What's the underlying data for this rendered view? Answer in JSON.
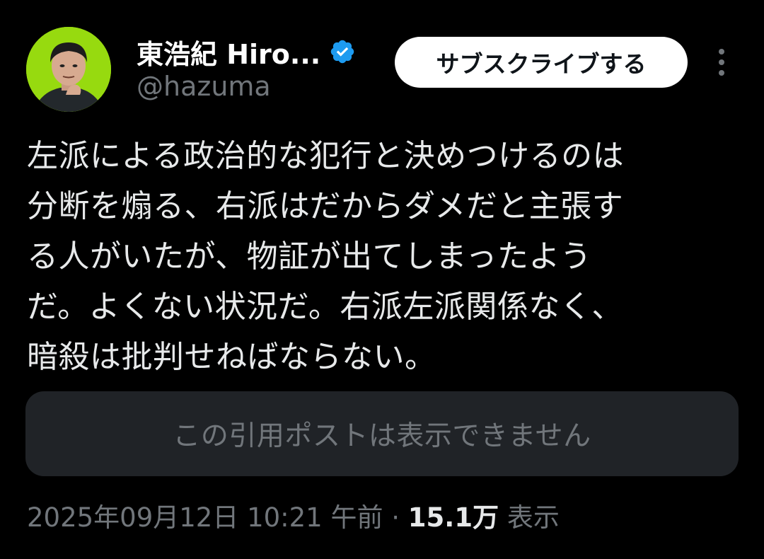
{
  "author": {
    "display_name": "東浩紀 Hiro...",
    "handle": "@hazuma",
    "verified_icon": "verified-badge-icon",
    "verified_color": "#1d9bf0",
    "avatar_bg": "#8fd400"
  },
  "actions": {
    "subscribe_label": "サブスクライブする",
    "more_icon": "more-vertical-icon"
  },
  "post": {
    "lines": [
      "左派による政治的な犯行と決めつけるのは",
      "分断を煽る、右派はだからダメだと主張す",
      "る人がいたが、物証が出てしまったよう",
      "だ。よくない状況だ。右派左派関係なく、",
      "暗殺は批判せねばならない。"
    ],
    "quote_unavailable": "この引用ポストは表示できません"
  },
  "meta": {
    "datetime": "2025年09月12日 10:21 午前",
    "separator": " · ",
    "views_count": "15.1万",
    "views_label": " 表示"
  }
}
